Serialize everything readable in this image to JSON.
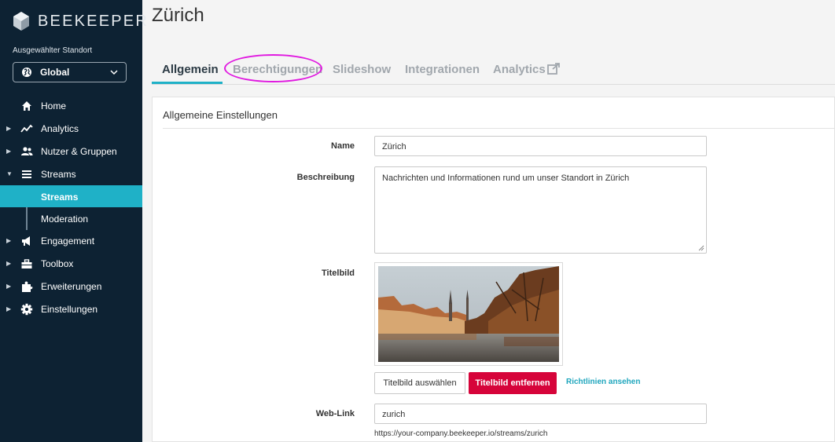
{
  "sidebar": {
    "brand": "BEEKEEPER",
    "location_label": "Ausgewählter Standort",
    "location_value": "Global",
    "nav": [
      {
        "label": "Home",
        "icon": "home-icon"
      },
      {
        "label": "Analytics",
        "icon": "analytics-icon"
      },
      {
        "label": "Nutzer & Gruppen",
        "icon": "users-icon"
      },
      {
        "label": "Streams",
        "icon": "streams-icon"
      },
      {
        "label": "Engagement",
        "icon": "megaphone-icon"
      },
      {
        "label": "Toolbox",
        "icon": "toolbox-icon"
      },
      {
        "label": "Erweiterungen",
        "icon": "puzzle-icon"
      },
      {
        "label": "Einstellungen",
        "icon": "gear-icon"
      }
    ],
    "streams_sub": [
      "Streams",
      "Moderation"
    ]
  },
  "page": {
    "title": "Zürich",
    "tabs": [
      "Allgemein",
      "Berechtigungen",
      "Slideshow",
      "Integrationen",
      "Analytics"
    ]
  },
  "form": {
    "section_title": "Allgemeine Einstellungen",
    "name_label": "Name",
    "name_value": "Zürich",
    "desc_label": "Beschreibung",
    "desc_value": "Nachrichten und Informationen rund um unser Standort in Zürich",
    "image_label": "Titelbild",
    "choose_image": "Titelbild auswählen",
    "remove_image": "Titelbild entfernen",
    "guidelines": "Richtlinien ansehen",
    "weblink_label": "Web-Link",
    "weblink_value": "zurich",
    "weblink_url": "https://your-company.beekeeper.io/streams/zurich"
  },
  "colors": {
    "sidebar_bg": "#0d2233",
    "accent": "#1fb1c7",
    "danger": "#d6043a",
    "annotation": "#e01ae0"
  }
}
